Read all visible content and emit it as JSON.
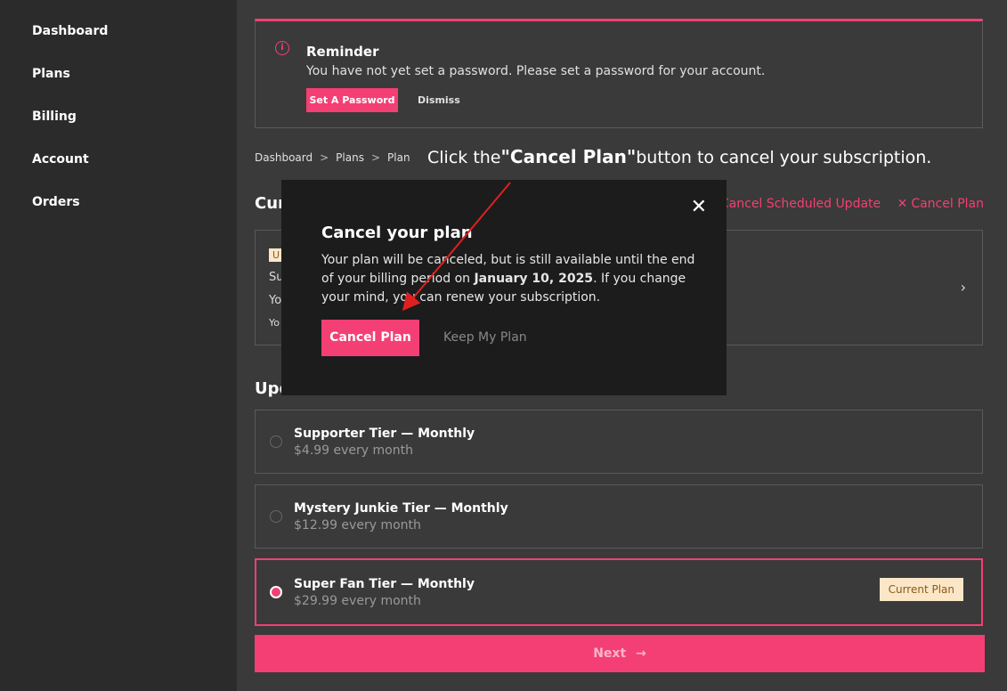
{
  "sidebar": {
    "items": [
      {
        "label": "Dashboard"
      },
      {
        "label": "Plans"
      },
      {
        "label": "Billing"
      },
      {
        "label": "Account"
      },
      {
        "label": "Orders"
      }
    ]
  },
  "reminder": {
    "icon": "info-icon",
    "title": "Reminder",
    "message": "You have not yet set a password. Please set a password for your account.",
    "set_password_label": "Set A Password",
    "dismiss_label": "Dismiss"
  },
  "breadcrumb": {
    "items": [
      "Dashboard",
      "Plans",
      "Plan"
    ],
    "separator": ">"
  },
  "instruction": {
    "before": "Click the",
    "highlight": "\"Cancel Plan\"",
    "after": "button to cancel your subscription."
  },
  "current_section": {
    "title_partial": "Cur",
    "cancel_scheduled_label": "Cancel Scheduled Update",
    "cancel_plan_label": "Cancel Plan",
    "card": {
      "badge_partial": "U",
      "line1_partial": "Su",
      "line2_partial": "Yo",
      "line3_partial": "Yo"
    }
  },
  "update_section": {
    "title_partial": "Upd"
  },
  "plans": [
    {
      "name": "Supporter Tier — Monthly",
      "price": "$4.99 every month",
      "selected": false
    },
    {
      "name": "Mystery Junkie Tier — Monthly",
      "price": "$12.99 every month",
      "selected": false
    },
    {
      "name": "Super Fan Tier — Monthly",
      "price": "$29.99 every month",
      "selected": true,
      "badge": "Current Plan"
    }
  ],
  "next_label": "Next",
  "modal": {
    "title": "Cancel your plan",
    "body_before": "Your plan will be canceled, but is still available until the end of your billing period on",
    "body_date": "January 10, 2025",
    "body_after": ". If you change your mind, you can renew your subscription.",
    "cancel_label": "Cancel Plan",
    "keep_label": "Keep My Plan",
    "close_icon": "close-icon"
  },
  "colors": {
    "accent": "#f43f74",
    "sidebar_bg": "#2b2b2b",
    "main_bg": "#3a3a3a",
    "modal_bg": "#1c1c1c",
    "arrow": "#e02020"
  }
}
